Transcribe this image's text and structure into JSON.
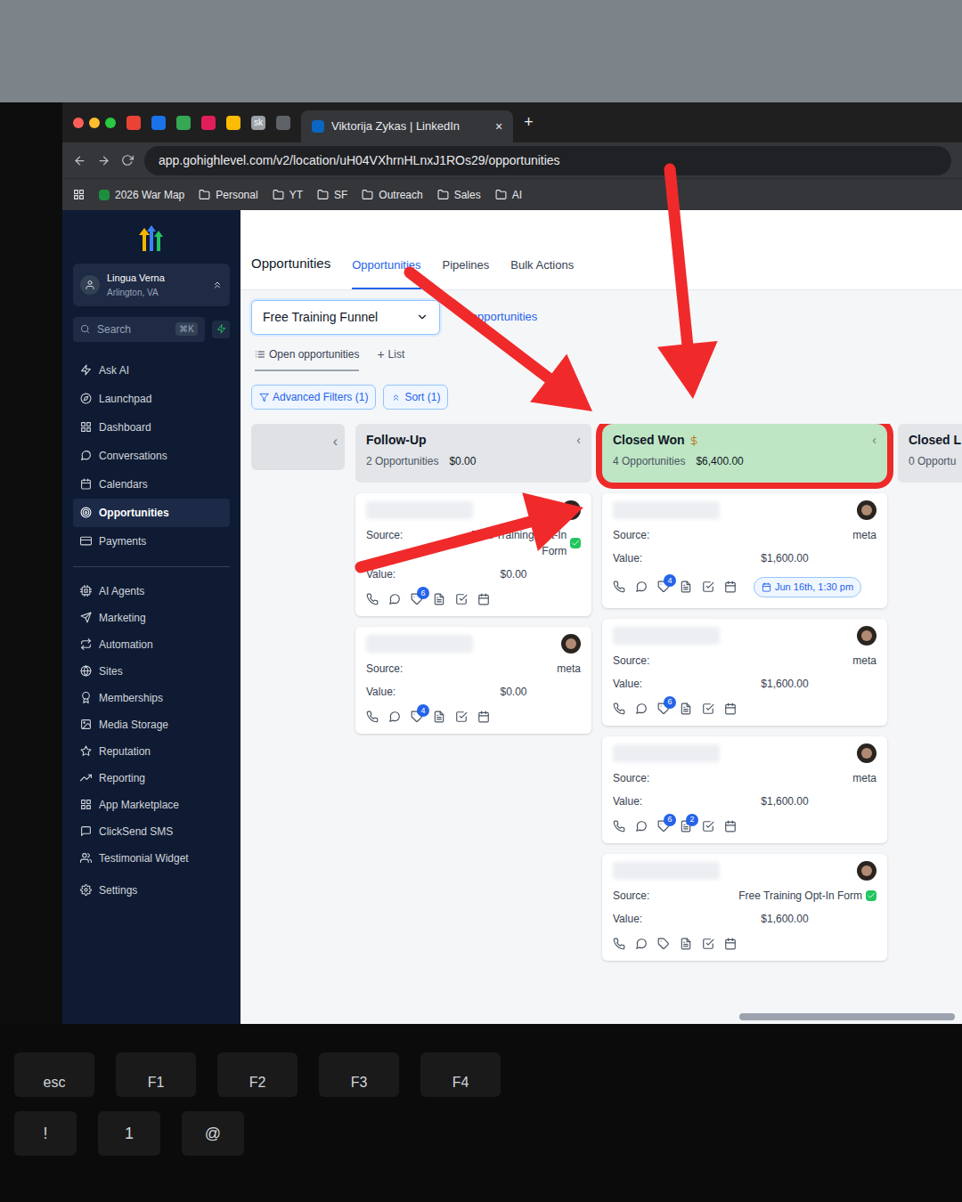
{
  "browser": {
    "favicons": [
      {
        "color": "#ea4335"
      },
      {
        "color": "#1a73e8"
      },
      {
        "color": "#34a853"
      },
      {
        "color": "#e01e5a"
      },
      {
        "color": "#fbbc04"
      },
      {
        "label": "sk",
        "color": "#9aa0a6"
      },
      {
        "color": "#5f6368"
      }
    ],
    "active_tab": {
      "title": "Viktorija Zykas | LinkedIn",
      "close": "×"
    },
    "new_tab": "+",
    "url": "app.gohighlevel.com/v2/location/uH04VXhrnHLnxJ1ROs29/opportunities",
    "bookmarks": [
      {
        "label": "2026 War Map",
        "kind": "link"
      },
      {
        "label": "Personal",
        "kind": "folder"
      },
      {
        "label": "YT",
        "kind": "folder"
      },
      {
        "label": "SF",
        "kind": "folder"
      },
      {
        "label": "Outreach",
        "kind": "folder"
      },
      {
        "label": "Sales",
        "kind": "folder"
      },
      {
        "label": "AI",
        "kind": "folder"
      }
    ]
  },
  "sidebar": {
    "account": {
      "name": "Lingua Verna",
      "location": "Arlington, VA"
    },
    "search": {
      "placeholder": "Search",
      "shortcut": "⌘K"
    },
    "items": [
      {
        "label": "Ask AI",
        "selected": false
      },
      {
        "label": "Launchpad",
        "selected": false
      },
      {
        "label": "Dashboard",
        "selected": false
      },
      {
        "label": "Conversations",
        "selected": false
      },
      {
        "label": "Calendars",
        "selected": false
      },
      {
        "label": "Opportunities",
        "selected": true
      },
      {
        "label": "Payments",
        "selected": false
      }
    ],
    "tools": [
      {
        "label": "AI Agents",
        "selected": false
      },
      {
        "label": "Marketing",
        "selected": false
      },
      {
        "label": "Automation",
        "selected": false
      },
      {
        "label": "Sites",
        "selected": false
      },
      {
        "label": "Memberships",
        "selected": false
      },
      {
        "label": "Media Storage",
        "selected": false
      },
      {
        "label": "Reputation",
        "selected": false
      },
      {
        "label": "Reporting",
        "selected": false
      },
      {
        "label": "App Marketplace",
        "selected": false
      },
      {
        "label": "ClickSend SMS",
        "selected": false
      },
      {
        "label": "Testimonial Widget",
        "selected": false
      }
    ],
    "settings": "Settings"
  },
  "page": {
    "title": "Opportunities",
    "tabs": [
      {
        "label": "Opportunities",
        "selected": true
      },
      {
        "label": "Pipelines",
        "selected": false
      },
      {
        "label": "Bulk Actions",
        "selected": false
      }
    ]
  },
  "pipeline": {
    "selected": "Free Training Funnel",
    "count": "0 opportunities"
  },
  "views": [
    {
      "label": "Open opportunities",
      "kind": "view",
      "selected": true
    },
    {
      "label": "List",
      "icon": "+",
      "kind": "add",
      "selected": false
    }
  ],
  "filters": [
    {
      "label": "Advanced Filters (1)",
      "kind": "filter"
    },
    {
      "label": "Sort (1)",
      "kind": "sort"
    }
  ],
  "columns": [
    {
      "kind": "collapsed",
      "toggle": "‹",
      "color": "#dfe1e5"
    },
    {
      "kind": "stage",
      "name": "Follow-Up",
      "money": false,
      "count": "2 Opportunities",
      "total": "$0.00",
      "toggle": "‹",
      "highlighted": false,
      "color": "#e3e5e8",
      "cards": [
        {
          "source_label": "Source:",
          "source": "Free Training Opt-In Form",
          "verified": true,
          "value_label": "Value:",
          "value": "$0.00",
          "tag_count": "6"
        },
        {
          "source_label": "Source:",
          "source": "meta",
          "verified": false,
          "value_label": "Value:",
          "value": "$0.00",
          "tag_count": "4"
        }
      ]
    },
    {
      "kind": "stage",
      "name": "Closed Won",
      "money": true,
      "count": "4 Opportunities",
      "total": "$6,400.00",
      "toggle": "‹",
      "highlighted": true,
      "color": "#bfe6c4",
      "cards": [
        {
          "source_label": "Source:",
          "source": "meta",
          "verified": false,
          "value_label": "Value:",
          "value": "$1,600.00",
          "tag_count": "4",
          "appointment": "Jun 16th, 1:30 pm"
        },
        {
          "source_label": "Source:",
          "source": "meta",
          "verified": false,
          "value_label": "Value:",
          "value": "$1,600.00",
          "tag_count": "6"
        },
        {
          "source_label": "Source:",
          "source": "meta",
          "verified": false,
          "value_label": "Value:",
          "value": "$1,600.00",
          "tag_count": "6",
          "note_count": "2"
        },
        {
          "source_label": "Source:",
          "source": "Free Training Opt-In Form",
          "verified": true,
          "value_label": "Value:",
          "value": "$1,600.00"
        }
      ]
    },
    {
      "kind": "stage",
      "name": "Closed L",
      "money": false,
      "count": "0 Opportu",
      "highlighted": false,
      "color": "#e3e5e8",
      "cards": []
    }
  ],
  "keyboard": {
    "function_keys": [
      {
        "label": "esc"
      },
      {
        "label": "F1"
      },
      {
        "label": "F2"
      },
      {
        "label": "F3"
      },
      {
        "label": "F4"
      }
    ],
    "number_keys": [
      {
        "label": "!"
      },
      {
        "label": "1"
      },
      {
        "label": "@"
      }
    ]
  }
}
